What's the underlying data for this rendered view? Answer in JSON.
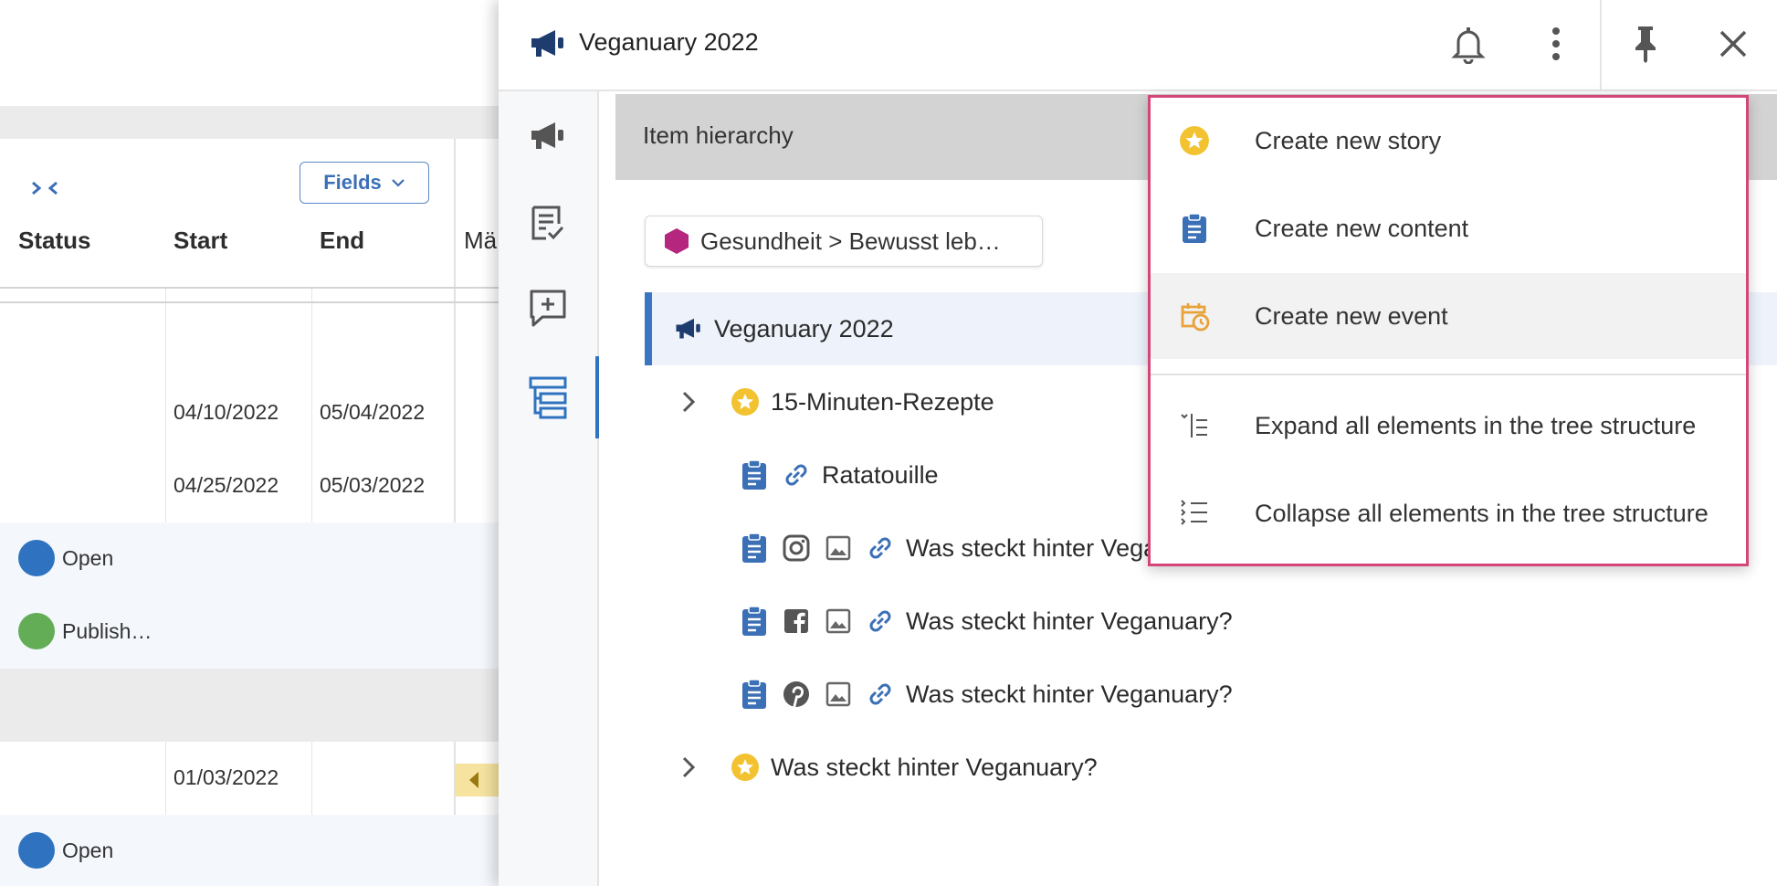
{
  "background_table": {
    "toggle_glyph": "›‹",
    "fields_button": "Fields",
    "columns": {
      "status": "Status",
      "start": "Start",
      "end": "End",
      "next": "Mä"
    },
    "rows": [
      {
        "start": "04/10/2022",
        "end": "05/04/2022"
      },
      {
        "start": "04/25/2022",
        "end": "05/03/2022"
      },
      {
        "status": "Open",
        "status_color": "#2f73c0"
      },
      {
        "status": "Publish…",
        "status_color": "#63ad57"
      },
      {
        "start": "01/03/2022"
      },
      {
        "status": "Open",
        "status_color": "#2f73c0"
      }
    ]
  },
  "panel": {
    "title": "Veganuary 2022",
    "breadcrumb": "Gesundheit > Bewusst leb…",
    "section_title": "Item hierarchy",
    "tree": [
      {
        "label": "Veganuary 2022"
      },
      {
        "label": "15-Minuten-Rezepte"
      },
      {
        "label": "Ratatouille"
      },
      {
        "label": "Was steckt hinter Veganuary?"
      },
      {
        "label": "Was steckt hinter Veganuary?"
      },
      {
        "label": "Was steckt hinter Veganuary?"
      },
      {
        "label": "Was steckt hinter Veganuary?"
      }
    ]
  },
  "menu": {
    "items": [
      {
        "label": "Create new story"
      },
      {
        "label": "Create new content"
      },
      {
        "label": "Create new event"
      },
      {
        "label": "Expand all elements in the tree structure"
      },
      {
        "label": "Collapse all elements in the tree structure"
      }
    ]
  },
  "colors": {
    "accent_blue": "#2f73c0",
    "navy": "#1e3d6e",
    "story_yellow": "#f2c230",
    "event_orange": "#e8a23a",
    "menu_border": "#d4467a",
    "topic_magenta": "#b5267e"
  }
}
